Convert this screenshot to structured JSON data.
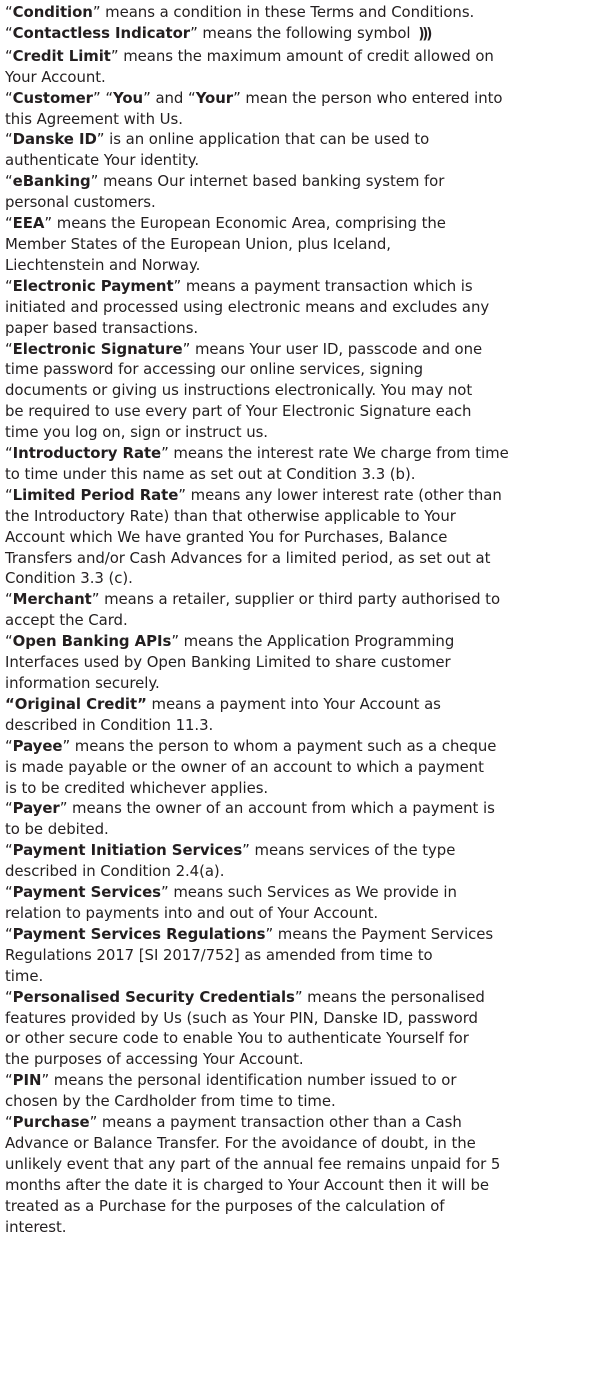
{
  "definitions": [
    {
      "term": "Condition",
      "lead": "“",
      "close": "” means",
      "lines": [
        "a condition in these Terms and Conditions."
      ]
    },
    {
      "term": "Contactless Indicator",
      "lead": "“",
      "close": "” means",
      "lines": [
        "the following symbol"
      ],
      "icon": "contactless-icon"
    },
    {
      "term": "Credit Limit",
      "lead": "“",
      "close": "” means",
      "lines": [
        "the maximum amount of credit allowed on",
        "Your Account."
      ]
    },
    {
      "term": "Customer",
      "lead": "“",
      "close": "”",
      "lines": [
        "“You” and “Your” mean the person who entered into",
        "this Agreement with Us."
      ],
      "extra_bold": [
        "You",
        "Your"
      ]
    },
    {
      "term": "Danske ID",
      "lead": "“",
      "close": "” is",
      "lines": [
        "an online application that can be used to",
        "authenticate Your identity."
      ]
    },
    {
      "term": "eBanking",
      "lead": "“",
      "close": "” means",
      "lines": [
        "Our internet based banking system for",
        "personal customers."
      ]
    },
    {
      "term": "EEA",
      "lead": "“",
      "close": "” means",
      "lines": [
        "the European Economic Area, comprising the",
        "Member States of the European Union, plus Iceland,",
        "Liechtenstein and Norway."
      ]
    },
    {
      "term": "Electronic Payment",
      "lead": "“",
      "close": "” means",
      "lines": [
        "a payment transaction which is",
        "initiated and processed using electronic means and excludes any",
        "paper based transactions."
      ]
    },
    {
      "term": "Electronic Signature",
      "lead": "“",
      "close": "” means",
      "lines": [
        "Your user ID, passcode and one",
        "time password for accessing our online services, signing",
        "documents or giving us instructions electronically.  You may not",
        "be required to use every part of Your Electronic Signature each",
        "time you log on, sign or instruct us."
      ]
    },
    {
      "term": "Introductory Rate",
      "lead": "“",
      "close": "” means",
      "lines": [
        "the interest rate We charge from time",
        "to time under this name as set out at Condition 3.3 (b)."
      ]
    },
    {
      "term": "Limited Period Rate",
      "lead": "“",
      "close": "” means",
      "lines": [
        "any lower interest rate (other than",
        "the Introductory Rate) than that otherwise applicable to Your",
        "Account which We have granted You for Purchases, Balance",
        "Transfers and/or Cash Advances for a limited period, as set out at",
        "Condition 3.3 (c)."
      ]
    },
    {
      "term": "Merchant",
      "lead": "“",
      "close": "” means",
      "lines": [
        "a retailer, supplier or third party authorised to",
        "accept the Card."
      ]
    },
    {
      "term": "Open Banking APIs",
      "lead": "“",
      "close": "” means",
      "lines": [
        "the Application Programming",
        "Interfaces used by Open Banking Limited to share customer",
        "information securely."
      ]
    },
    {
      "term": "Original Credit",
      "lead": "“",
      "close": "” means",
      "lines": [
        "a payment into Your Account as",
        "described in Condition 11.3."
      ],
      "bold_quotes": true
    },
    {
      "term": "Payee",
      "lead": "“",
      "close": "” means",
      "lines": [
        "the person to whom a payment such as a cheque",
        "is made payable or the owner of an account to which a payment",
        "is to be credited whichever applies."
      ]
    },
    {
      "term": "Payer",
      "lead": "“",
      "close": "” means",
      "lines": [
        "the owner of an account from which a payment is",
        "to be debited."
      ]
    },
    {
      "term": "Payment Initiation Services",
      "lead": "“",
      "close": "” means",
      "lines": [
        "services of the type",
        "described in Condition 2.4(a)."
      ]
    },
    {
      "term": "Payment Services",
      "lead": "“",
      "close": "” means",
      "lines": [
        "such Services as We provide in",
        "relation to payments into and out of Your Account."
      ]
    },
    {
      "term": "Payment Services Regulations",
      "lead": "“",
      "close": "” means",
      "lines": [
        "the Payment Services",
        "Regulations 2017 [SI 2017/752] as amended from time to",
        "time."
      ]
    },
    {
      "term": "Personalised Security Credentials",
      "lead": "“",
      "close": "” means",
      "lines": [
        "the personalised",
        "features provided by Us (such as Your PIN, Danske ID, password",
        "or other secure code to enable You to authenticate Yourself for",
        "the purposes of accessing Your Account."
      ]
    },
    {
      "term": "PIN",
      "lead": "“",
      "close": "” means",
      "lines": [
        "the personal identification number issued to or",
        "chosen by the Cardholder from time to time."
      ]
    },
    {
      "term": "Purchase",
      "lead": "“",
      "close": "” means",
      "lines": [
        "a payment transaction other than a Cash",
        "Advance or Balance Transfer. For the avoidance of doubt, in the",
        "unlikely event that any part of the annual fee remains unpaid for 5",
        "months after the date it is charged to Your Account then it will be",
        "treated as a Purchase for the purposes of the calculation of",
        "interest."
      ]
    }
  ]
}
